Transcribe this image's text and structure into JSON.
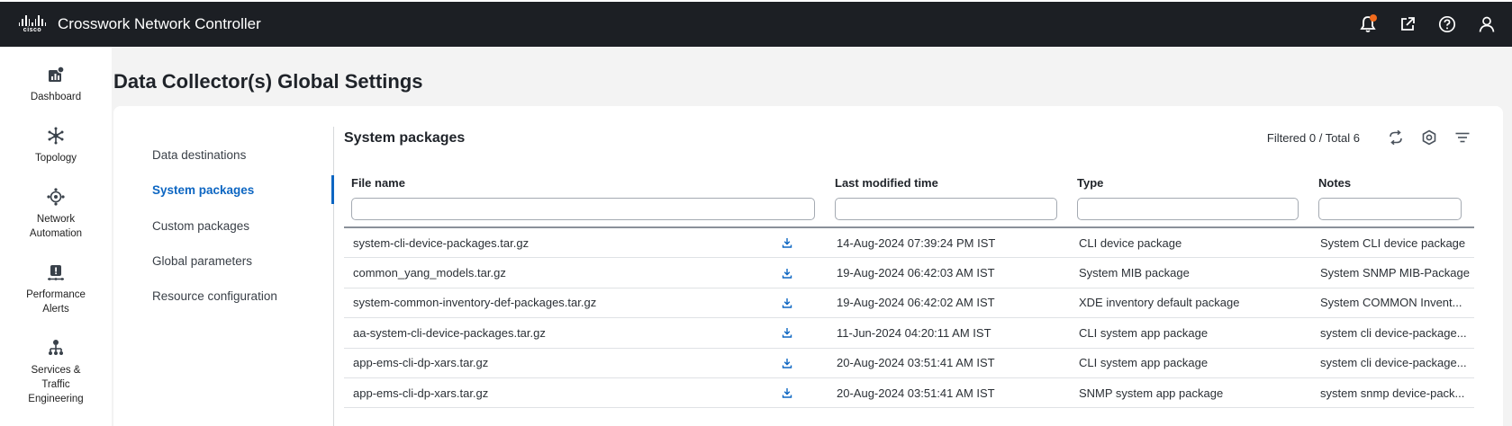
{
  "app": {
    "title": "Crosswork Network Controller",
    "logo_text": "cisco",
    "accent_color": "#0d66c2",
    "notification_color": "#f26b1d"
  },
  "top_icons": [
    "bell-icon",
    "external-link-icon",
    "help-icon",
    "user-icon"
  ],
  "sidebar": {
    "items": [
      {
        "icon": "dashboard-icon",
        "label_lines": [
          "Dashboard"
        ]
      },
      {
        "icon": "topology-icon",
        "label_lines": [
          "Topology"
        ]
      },
      {
        "icon": "network-automation-icon",
        "label_lines": [
          "Network",
          "Automation"
        ]
      },
      {
        "icon": "performance-alerts-icon",
        "label_lines": [
          "Performance",
          "Alerts"
        ]
      },
      {
        "icon": "services-icon",
        "label_lines": [
          "Services &",
          "Traffic",
          "Engineering"
        ]
      }
    ]
  },
  "page": {
    "title": "Data Collector(s) Global Settings"
  },
  "subnav": {
    "items": [
      {
        "label": "Data destinations",
        "active": false
      },
      {
        "label": "System packages",
        "active": true
      },
      {
        "label": "Custom packages",
        "active": false
      },
      {
        "label": "Global parameters",
        "active": false
      },
      {
        "label": "Resource configuration",
        "active": false
      }
    ]
  },
  "section": {
    "title": "System packages",
    "filter_status": "Filtered 0 / Total 6"
  },
  "table": {
    "columns": [
      "File name",
      "Last modified time",
      "Type",
      "Notes"
    ],
    "filters": [
      "",
      "",
      "",
      ""
    ],
    "rows": [
      {
        "file": "system-cli-device-packages.tar.gz",
        "time": "14-Aug-2024 07:39:24 PM IST",
        "type": "CLI device package",
        "notes": "System CLI device package"
      },
      {
        "file": "common_yang_models.tar.gz",
        "time": "19-Aug-2024 06:42:03 AM IST",
        "type": "System MIB package",
        "notes": "System SNMP MIB-Package"
      },
      {
        "file": "system-common-inventory-def-packages.tar.gz",
        "time": "19-Aug-2024 06:42:02 AM IST",
        "type": "XDE inventory default package",
        "notes": "System COMMON Invent..."
      },
      {
        "file": "aa-system-cli-device-packages.tar.gz",
        "time": "11-Jun-2024 04:20:11 AM IST",
        "type": "CLI system app package",
        "notes": "system cli device-package..."
      },
      {
        "file": "app-ems-cli-dp-xars.tar.gz",
        "time": "20-Aug-2024 03:51:41 AM IST",
        "type": "CLI system app package",
        "notes": "system cli device-package..."
      },
      {
        "file": "app-ems-cli-dp-xars.tar.gz",
        "time": "20-Aug-2024 03:51:41 AM IST",
        "type": "SNMP system app package",
        "notes": "system snmp device-pack..."
      }
    ]
  }
}
